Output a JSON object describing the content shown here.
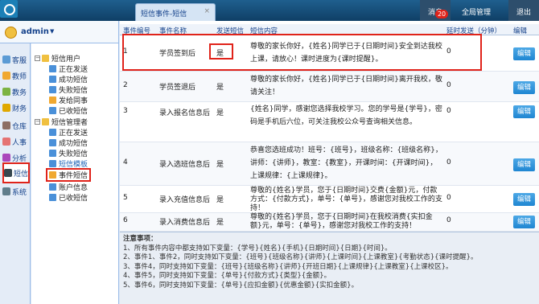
{
  "top": {
    "tab_label": "短信事件-短信",
    "tab_close": "×",
    "nav": {
      "messages": "消息",
      "message_count": "20",
      "global": "全局管理",
      "exit": "退出"
    }
  },
  "user": {
    "name": "admin",
    "arrow": "▼"
  },
  "modules": [
    "客服",
    "教师",
    "教务",
    "财务",
    "仓库",
    "人事",
    "分析",
    "短信",
    "系统"
  ],
  "tree": {
    "group1": "短信用户",
    "group1_items": [
      "正在发送",
      "成功短信",
      "失败短信",
      "发给同事",
      "已收短信"
    ],
    "group2": "短信管理者",
    "group2_items": [
      "正在发送",
      "成功短信",
      "失败短信",
      "短信模板",
      "事件短信",
      "账户信息",
      "已收短信"
    ]
  },
  "grid": {
    "headers": [
      "事件编号",
      "事件名称",
      "发送短信",
      "短信内容",
      "延时发送（分钟）",
      "编辑"
    ],
    "rows": [
      {
        "id": "1",
        "name": "学员签到后",
        "send": "是",
        "content": "尊敬的家长你好，{姓名}同学已于{日期时间}安全到达我校上课，请放心！课时进度为{课时提醒}。",
        "delay": "0",
        "edit": "编辑"
      },
      {
        "id": "2",
        "name": "学员签退后",
        "send": "是",
        "content": "尊敬的家长你好，{姓名}同学已于{日期时间}离开我校，敬请关注！",
        "delay": "0",
        "edit": "编辑"
      },
      {
        "id": "3",
        "name": "录入报名信息后",
        "send": "是",
        "content": "{姓名}同学，感谢您选择我校学习。您的学号是{学号}，密码是手机后六位，可关注我校公众号查询相关信息。",
        "delay": "0",
        "edit": "编辑"
      },
      {
        "id": "4",
        "name": "录入选班信息后",
        "send": "是",
        "content": "恭喜您选班成功！班号：{班号}，班级名称：{班级名称}，讲师：{讲师}，教室：{教室}，开课时间：{开课时间}，上课规律：{上课规律}。",
        "delay": "0",
        "edit": "编辑"
      },
      {
        "id": "5",
        "name": "录入充值信息后",
        "send": "是",
        "content": "尊敬的{姓名}学员，您于{日期时间}交费{金额}元，付款方式：{付款方式}，单号：{单号}，感谢您对我校工作的支持！",
        "delay": "0",
        "edit": "编辑"
      },
      {
        "id": "6",
        "name": "录入消费信息后",
        "send": "是",
        "content": "尊敬的{姓名}学员，您于{日期时间}在我校消费{实扣金额}元，单号：{单号}，感谢您对我校工作的支持！",
        "delay": "0",
        "edit": "编辑"
      }
    ]
  },
  "notes": {
    "title": "注意事项：",
    "lines": [
      "1、所有事件内容中都支持如下变量：{学号}{姓名}{手机}{日期时间}{日期}{时间}。",
      "2、事件1、事件2，同时支持如下变量：{班号}{班级名称}{讲师}{上课时间}{上课教室}{考勤状态}{课时提醒}。",
      "3、事件4，同时支持如下变量：{班号}{班级名称}{讲师}{开班日期}{上课规律}{上课教室}{上课校区}。",
      "4、事件5，同时支持如下变量：{单号}{付款方式}{类型}{金额}。",
      "5、事件6，同时支持如下变量：{单号}{应扣金额}{优惠金额}{实扣金额}。"
    ]
  },
  "colors": {
    "accent": "#1f86d2",
    "highlight": "#e0231a",
    "header": "#15428b"
  }
}
